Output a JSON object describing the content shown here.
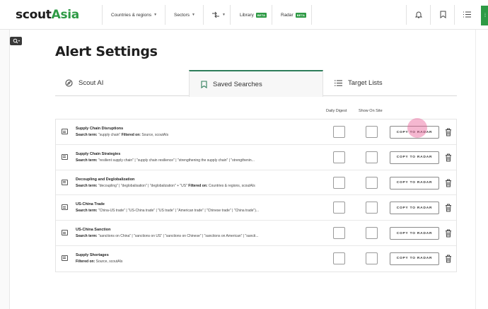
{
  "app": {
    "logo_part1": "scout",
    "logo_part2": "Asia"
  },
  "nav": {
    "countries": "Countries & regions",
    "sectors": "Sectors",
    "library": "Library",
    "library_badge": "BETA",
    "radar": "Radar",
    "radar_badge": "BETA"
  },
  "page": {
    "title": "Alert Settings"
  },
  "tabs": [
    {
      "label": "Scout AI",
      "icon": "compass-icon"
    },
    {
      "label": "Saved Searches",
      "icon": "bookmark-icon",
      "active": true
    },
    {
      "label": "Target Lists",
      "icon": "list-icon"
    }
  ],
  "table": {
    "col_daily_digest": "Daily Digest",
    "col_show_on_site": "Show On Site",
    "copy_label": "COPY TO RADAR",
    "rows": [
      {
        "name": "Supply Chain Disruptions",
        "term_label": "Search term:",
        "term": "\"supply chain\"",
        "filter_label": "Filtered on:",
        "filter": "Source, scoutAIs"
      },
      {
        "name": "Supply Chain Strategies",
        "term_label": "Search term:",
        "term": "\"resilient supply chain\" | \"supply chain resilience\" | \"strengthening the supply chain\" | \"strengthenin...",
        "filter_label": "",
        "filter": ""
      },
      {
        "name": "Decoupling and Deglobalization",
        "term_label": "Search term:",
        "term": "\"decoupling\" | \"deglobalisation\" | \"deglobalization\" + \"US\"",
        "filter_label": "Filtered on:",
        "filter": "Countries & regions, scoutAIs"
      },
      {
        "name": "US-China Trade",
        "term_label": "Search term:",
        "term": "\"China-US trade\" | \"US-China trade\" | \"US trade\" | \"American trade\" | \"Chinese trade\" | \"China trade\")...",
        "filter_label": "",
        "filter": ""
      },
      {
        "name": "US-China Sanction",
        "term_label": "Search term:",
        "term": "\"sanctions on China\" | \"sanctions on US\" | \"sanctions on Chinese\" | \"sanctions on American\" | \"sancti...",
        "filter_label": "",
        "filter": ""
      },
      {
        "name": "Supply Shortages",
        "term_label": "",
        "term": "",
        "filter_label": "Filtered on:",
        "filter": "Source, scoutAIs"
      }
    ]
  },
  "colors": {
    "brand_green": "#2e9a45",
    "active_tab_border": "#2e7d5a",
    "cursor_highlight": "#e85f96"
  }
}
